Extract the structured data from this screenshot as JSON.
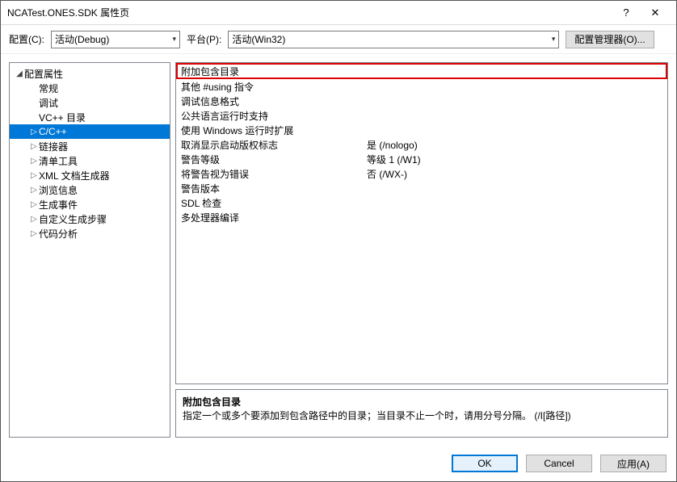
{
  "title": "NCATest.ONES.SDK 属性页",
  "help_btn": "?",
  "close_btn": "✕",
  "toolbar": {
    "config_label": "配置(C):",
    "config_value": "活动(Debug)",
    "platform_label": "平台(P):",
    "platform_value": "活动(Win32)",
    "manager_btn": "配置管理器(O)..."
  },
  "tree": {
    "root": "配置属性",
    "items": [
      "常规",
      "调试",
      "VC++ 目录",
      "C/C++",
      "链接器",
      "清单工具",
      "XML 文档生成器",
      "浏览信息",
      "生成事件",
      "自定义生成步骤",
      "代码分析"
    ]
  },
  "grid": [
    {
      "k": "附加包含目录",
      "v": ""
    },
    {
      "k": "其他 #using 指令",
      "v": ""
    },
    {
      "k": "调试信息格式",
      "v": ""
    },
    {
      "k": "公共语言运行时支持",
      "v": ""
    },
    {
      "k": "使用 Windows 运行时扩展",
      "v": ""
    },
    {
      "k": "取消显示启动版权标志",
      "v": "是 (/nologo)"
    },
    {
      "k": "警告等级",
      "v": "等级 1 (/W1)"
    },
    {
      "k": "将警告视为错误",
      "v": "否 (/WX-)"
    },
    {
      "k": "警告版本",
      "v": ""
    },
    {
      "k": "SDL 检查",
      "v": ""
    },
    {
      "k": "多处理器编译",
      "v": ""
    }
  ],
  "desc": {
    "heading": "附加包含目录",
    "text": "指定一个或多个要添加到包含路径中的目录；当目录不止一个时，请用分号分隔。     (/I[路径])"
  },
  "footer": {
    "ok": "OK",
    "cancel": "Cancel",
    "apply": "应用(A)"
  }
}
